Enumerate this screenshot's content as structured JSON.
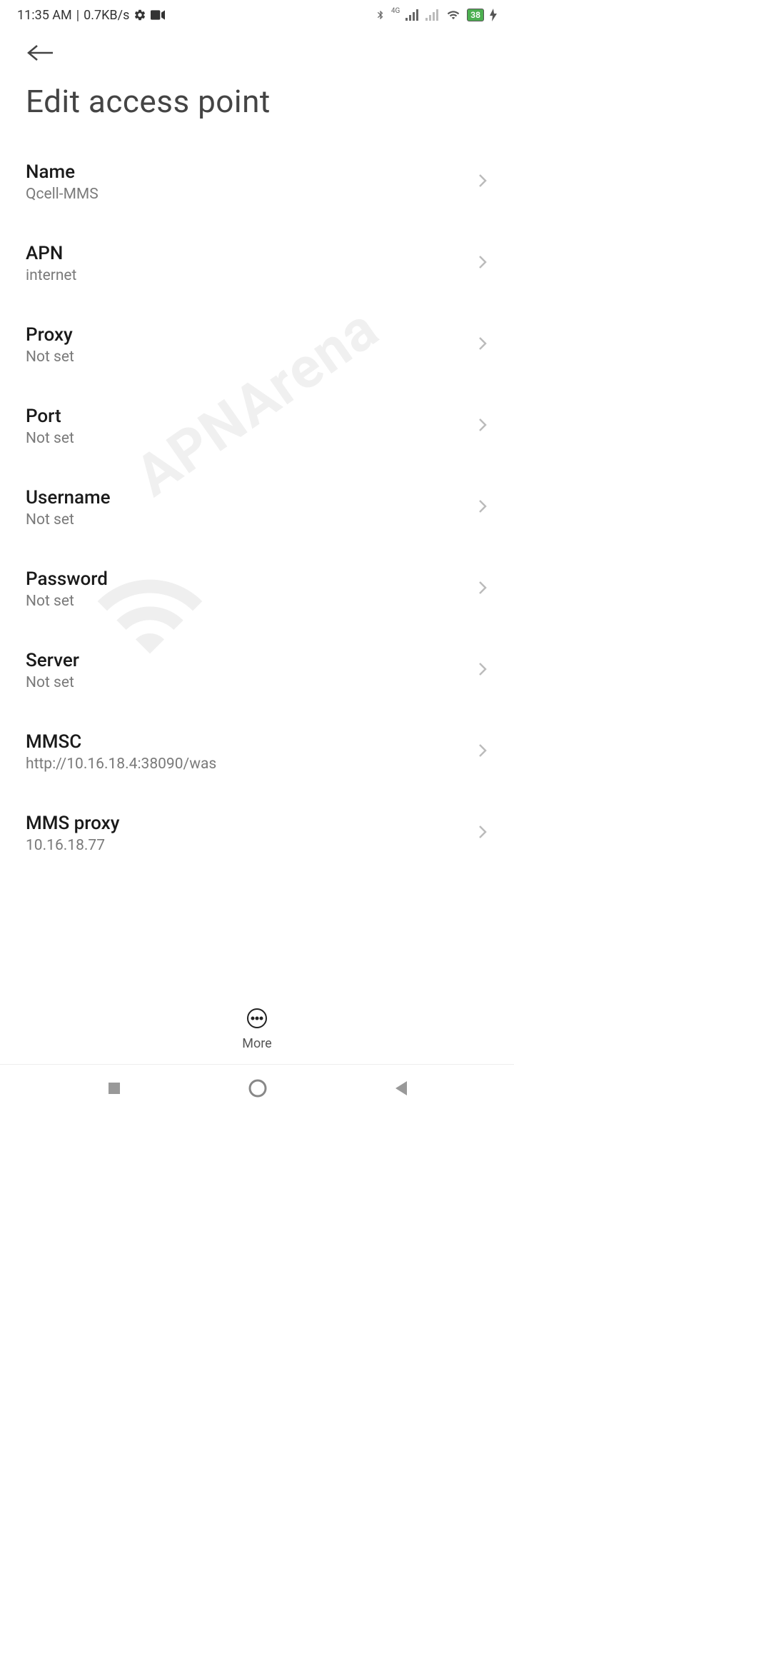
{
  "statusBar": {
    "time": "11:35 AM",
    "dataRate": "0.7KB/s",
    "battery": "38",
    "networkLabel": "4G"
  },
  "header": {
    "title": "Edit access point"
  },
  "settings": [
    {
      "label": "Name",
      "value": "Qcell-MMS"
    },
    {
      "label": "APN",
      "value": "internet"
    },
    {
      "label": "Proxy",
      "value": "Not set"
    },
    {
      "label": "Port",
      "value": "Not set"
    },
    {
      "label": "Username",
      "value": "Not set"
    },
    {
      "label": "Password",
      "value": "Not set"
    },
    {
      "label": "Server",
      "value": "Not set"
    },
    {
      "label": "MMSC",
      "value": "http://10.16.18.4:38090/was"
    },
    {
      "label": "MMS proxy",
      "value": "10.16.18.77"
    }
  ],
  "toolbar": {
    "moreLabel": "More"
  },
  "watermark": "APNArena"
}
